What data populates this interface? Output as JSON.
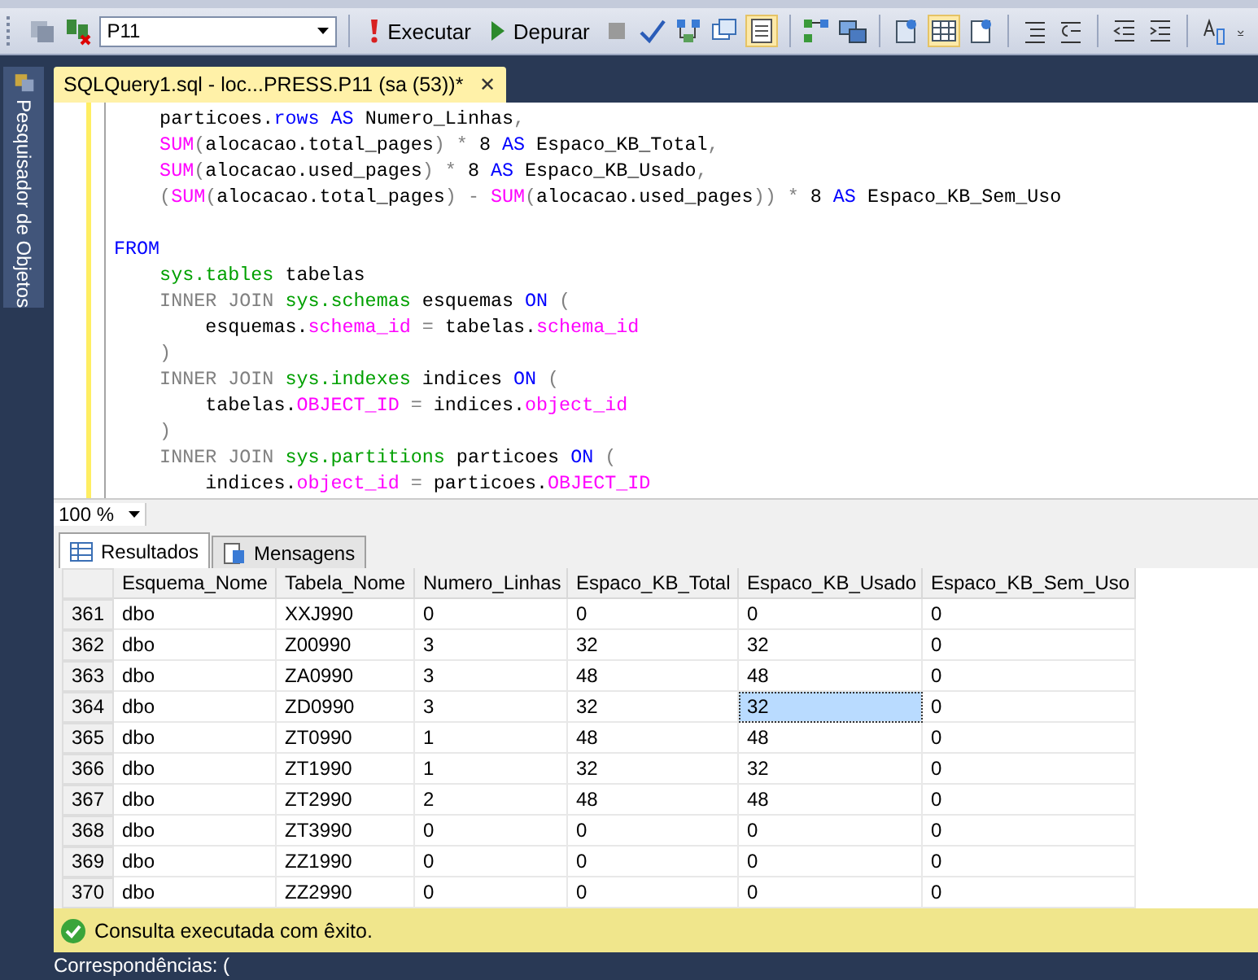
{
  "toolbar": {
    "database": "P11",
    "buttons": [
      {
        "label": "Executar",
        "kind": "execute"
      },
      {
        "label": "Depurar",
        "kind": "debug"
      }
    ]
  },
  "sidebar": {
    "label": "Pesquisador de Objetos"
  },
  "document_tab": {
    "title": "SQLQuery1.sql - loc...PRESS.P11 (sa (53))*",
    "close": "✕"
  },
  "editor": {
    "lines": [
      {
        "kind": "code",
        "tokens": [
          {
            "kind": "txt",
            "t": "    particoes."
          },
          {
            "kind": "kw",
            "t": "rows"
          },
          {
            "kind": "kw",
            "t": " AS"
          },
          {
            "kind": "txt",
            "t": " Numero_Linhas"
          },
          {
            "kind": "op",
            "t": ","
          }
        ]
      },
      {
        "kind": "code",
        "tokens": [
          {
            "kind": "fn",
            "t": "    SUM"
          },
          {
            "kind": "op",
            "t": "("
          },
          {
            "kind": "txt",
            "t": "alocacao.total_pages"
          },
          {
            "kind": "op",
            "t": ") * "
          },
          {
            "kind": "txt",
            "t": "8 "
          },
          {
            "kind": "kw",
            "t": "AS"
          },
          {
            "kind": "txt",
            "t": " Espaco_KB_Total"
          },
          {
            "kind": "op",
            "t": ","
          }
        ]
      },
      {
        "kind": "code",
        "tokens": [
          {
            "kind": "fn",
            "t": "    SUM"
          },
          {
            "kind": "op",
            "t": "("
          },
          {
            "kind": "txt",
            "t": "alocacao.used_pages"
          },
          {
            "kind": "op",
            "t": ") * "
          },
          {
            "kind": "txt",
            "t": "8 "
          },
          {
            "kind": "kw",
            "t": "AS"
          },
          {
            "kind": "txt",
            "t": " Espaco_KB_Usado"
          },
          {
            "kind": "op",
            "t": ","
          }
        ]
      },
      {
        "kind": "code",
        "tokens": [
          {
            "kind": "op",
            "t": "    ("
          },
          {
            "kind": "fn",
            "t": "SUM"
          },
          {
            "kind": "op",
            "t": "("
          },
          {
            "kind": "txt",
            "t": "alocacao.total_pages"
          },
          {
            "kind": "op",
            "t": ") - "
          },
          {
            "kind": "fn",
            "t": "SUM"
          },
          {
            "kind": "op",
            "t": "("
          },
          {
            "kind": "txt",
            "t": "alocacao.used_pages"
          },
          {
            "kind": "op",
            "t": ")) * "
          },
          {
            "kind": "txt",
            "t": "8 "
          },
          {
            "kind": "kw",
            "t": "AS"
          },
          {
            "kind": "txt",
            "t": " Espaco_KB_Sem_Uso"
          }
        ]
      },
      {
        "kind": "blank"
      },
      {
        "kind": "code",
        "tokens": [
          {
            "kind": "kw",
            "t": "FROM"
          }
        ]
      },
      {
        "kind": "code",
        "tokens": [
          {
            "kind": "sys",
            "t": "    sys.tables"
          },
          {
            "kind": "txt",
            "t": " tabelas"
          }
        ]
      },
      {
        "kind": "code",
        "tokens": [
          {
            "kind": "op",
            "t": "    INNER JOIN"
          },
          {
            "kind": "sys",
            "t": " sys.schemas"
          },
          {
            "kind": "txt",
            "t": " esquemas "
          },
          {
            "kind": "kw",
            "t": "ON"
          },
          {
            "kind": "op",
            "t": " ("
          }
        ]
      },
      {
        "kind": "code",
        "tokens": [
          {
            "kind": "txt",
            "t": "        esquemas."
          },
          {
            "kind": "fn",
            "t": "schema_id"
          },
          {
            "kind": "op",
            "t": " = "
          },
          {
            "kind": "txt",
            "t": "tabelas."
          },
          {
            "kind": "fn",
            "t": "schema_id"
          }
        ]
      },
      {
        "kind": "code",
        "tokens": [
          {
            "kind": "op",
            "t": "    )"
          }
        ]
      },
      {
        "kind": "code",
        "tokens": [
          {
            "kind": "op",
            "t": "    INNER JOIN"
          },
          {
            "kind": "sys",
            "t": " sys.indexes"
          },
          {
            "kind": "txt",
            "t": " indices "
          },
          {
            "kind": "kw",
            "t": "ON"
          },
          {
            "kind": "op",
            "t": " ("
          }
        ]
      },
      {
        "kind": "code",
        "tokens": [
          {
            "kind": "txt",
            "t": "        tabelas."
          },
          {
            "kind": "fn",
            "t": "OBJECT_ID"
          },
          {
            "kind": "op",
            "t": " = "
          },
          {
            "kind": "txt",
            "t": "indices."
          },
          {
            "kind": "fn",
            "t": "object_id"
          }
        ]
      },
      {
        "kind": "code",
        "tokens": [
          {
            "kind": "op",
            "t": "    )"
          }
        ]
      },
      {
        "kind": "code",
        "tokens": [
          {
            "kind": "op",
            "t": "    INNER JOIN"
          },
          {
            "kind": "sys",
            "t": " sys.partitions"
          },
          {
            "kind": "txt",
            "t": " particoes "
          },
          {
            "kind": "kw",
            "t": "ON"
          },
          {
            "kind": "op",
            "t": " ("
          }
        ]
      },
      {
        "kind": "code",
        "tokens": [
          {
            "kind": "txt",
            "t": "        indices."
          },
          {
            "kind": "fn",
            "t": "object_id"
          },
          {
            "kind": "op",
            "t": " = "
          },
          {
            "kind": "txt",
            "t": "particoes."
          },
          {
            "kind": "fn",
            "t": "OBJECT_ID"
          }
        ]
      }
    ]
  },
  "zoom": {
    "value": "100 %"
  },
  "result_tabs": [
    {
      "label": "Resultados",
      "selected": true
    },
    {
      "label": "Mensagens",
      "selected": false
    }
  ],
  "table": {
    "columns": [
      "Esquema_Nome",
      "Tabela_Nome",
      "Numero_Linhas",
      "Espaco_KB_Total",
      "Espaco_KB_Usado",
      "Espaco_KB_Sem_Uso"
    ],
    "rows": [
      {
        "number": "361",
        "cells": [
          {
            "text": "dbo",
            "selected": false
          },
          {
            "text": "XXJ990",
            "selected": false
          },
          {
            "text": "0",
            "selected": false
          },
          {
            "text": "0",
            "selected": false
          },
          {
            "text": "0",
            "selected": false
          },
          {
            "text": "0",
            "selected": false
          }
        ]
      },
      {
        "number": "362",
        "cells": [
          {
            "text": "dbo",
            "selected": false
          },
          {
            "text": "Z00990",
            "selected": false
          },
          {
            "text": "3",
            "selected": false
          },
          {
            "text": "32",
            "selected": false
          },
          {
            "text": "32",
            "selected": false
          },
          {
            "text": "0",
            "selected": false
          }
        ]
      },
      {
        "number": "363",
        "cells": [
          {
            "text": "dbo",
            "selected": false
          },
          {
            "text": "ZA0990",
            "selected": false
          },
          {
            "text": "3",
            "selected": false
          },
          {
            "text": "48",
            "selected": false
          },
          {
            "text": "48",
            "selected": false
          },
          {
            "text": "0",
            "selected": false
          }
        ]
      },
      {
        "number": "364",
        "cells": [
          {
            "text": "dbo",
            "selected": false
          },
          {
            "text": "ZD0990",
            "selected": false
          },
          {
            "text": "3",
            "selected": false
          },
          {
            "text": "32",
            "selected": false
          },
          {
            "text": "32",
            "selected": true
          },
          {
            "text": "0",
            "selected": false
          }
        ]
      },
      {
        "number": "365",
        "cells": [
          {
            "text": "dbo",
            "selected": false
          },
          {
            "text": "ZT0990",
            "selected": false
          },
          {
            "text": "1",
            "selected": false
          },
          {
            "text": "48",
            "selected": false
          },
          {
            "text": "48",
            "selected": false
          },
          {
            "text": "0",
            "selected": false
          }
        ]
      },
      {
        "number": "366",
        "cells": [
          {
            "text": "dbo",
            "selected": false
          },
          {
            "text": "ZT1990",
            "selected": false
          },
          {
            "text": "1",
            "selected": false
          },
          {
            "text": "32",
            "selected": false
          },
          {
            "text": "32",
            "selected": false
          },
          {
            "text": "0",
            "selected": false
          }
        ]
      },
      {
        "number": "367",
        "cells": [
          {
            "text": "dbo",
            "selected": false
          },
          {
            "text": "ZT2990",
            "selected": false
          },
          {
            "text": "2",
            "selected": false
          },
          {
            "text": "48",
            "selected": false
          },
          {
            "text": "48",
            "selected": false
          },
          {
            "text": "0",
            "selected": false
          }
        ]
      },
      {
        "number": "368",
        "cells": [
          {
            "text": "dbo",
            "selected": false
          },
          {
            "text": "ZT3990",
            "selected": false
          },
          {
            "text": "0",
            "selected": false
          },
          {
            "text": "0",
            "selected": false
          },
          {
            "text": "0",
            "selected": false
          },
          {
            "text": "0",
            "selected": false
          }
        ]
      },
      {
        "number": "369",
        "cells": [
          {
            "text": "dbo",
            "selected": false
          },
          {
            "text": "ZZ1990",
            "selected": false
          },
          {
            "text": "0",
            "selected": false
          },
          {
            "text": "0",
            "selected": false
          },
          {
            "text": "0",
            "selected": false
          },
          {
            "text": "0",
            "selected": false
          }
        ]
      },
      {
        "number": "370",
        "cells": [
          {
            "text": "dbo",
            "selected": false
          },
          {
            "text": "ZZ2990",
            "selected": false
          },
          {
            "text": "0",
            "selected": false
          },
          {
            "text": "0",
            "selected": false
          },
          {
            "text": "0",
            "selected": false
          },
          {
            "text": "0",
            "selected": false
          }
        ]
      }
    ]
  },
  "status_bar": {
    "message": "Consulta executada com êxito."
  },
  "find_bar": {
    "label": "Correspondências: ("
  }
}
